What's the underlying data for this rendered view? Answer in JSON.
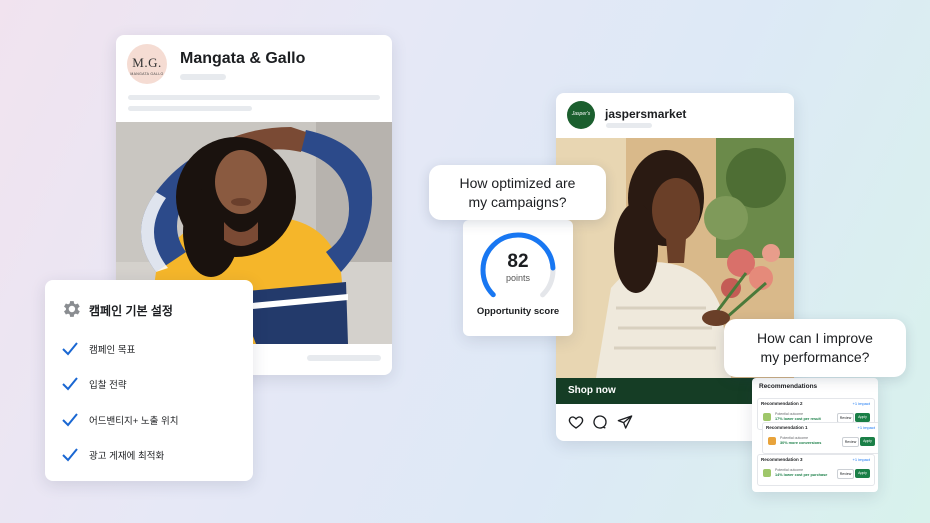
{
  "mangata": {
    "logo_monogram": "M.G.",
    "logo_sub": "MANGATA GALLO",
    "name": "Mangata & Gallo"
  },
  "settings": {
    "title": "캠페인 기본 설정",
    "items": [
      "캠페인 목표",
      "입찰 전략",
      "어드밴티지+ 노출 위치",
      "광고 게재에 최적화"
    ]
  },
  "jaspers": {
    "logo_text": "Jasper's",
    "name": "jaspersmarket",
    "shop_label": "Shop now"
  },
  "bubble_opt": {
    "line1": "How optimized are",
    "line2": "my campaigns?"
  },
  "score": {
    "value": "82",
    "unit": "points",
    "label": "Opportunity score",
    "fraction": 0.82,
    "color": "#1877f2"
  },
  "bubble_perf": {
    "line1": "How can I improve",
    "line2": "my performance?"
  },
  "recommendations": {
    "title": "Recommendations",
    "items": [
      {
        "name": "Recommendation 2",
        "link": "+1 impact",
        "potential": "Potential outcome",
        "value": "17% lower cost per result",
        "review": "Review",
        "apply": "Apply"
      },
      {
        "name": "Recommendation 1",
        "link": "+1 impact",
        "potential": "Potential outcome",
        "value": "30% more conversions",
        "review": "Review",
        "apply": "Apply"
      },
      {
        "name": "Recommendation 3",
        "link": "+1 impact",
        "potential": "Potential outcome",
        "value": "14% lower cost per purchase",
        "review": "Review",
        "apply": "Apply"
      }
    ]
  },
  "icons": [
    "heart-icon",
    "comment-icon",
    "share-icon",
    "gear-icon",
    "check-icon"
  ],
  "colors": {
    "accent_blue": "#1877f2",
    "brand_green": "#1b5f2e",
    "shop_bar": "#153d25",
    "check_blue": "#1a67d2"
  }
}
